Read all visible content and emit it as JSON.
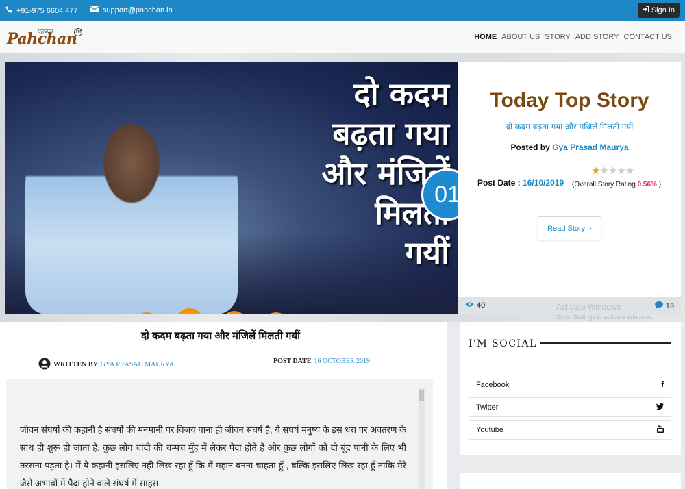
{
  "topbar": {
    "phone": "+91-975 6604 477",
    "email": "support@pahchan.in",
    "signin": "Sign In"
  },
  "logo": {
    "main": "Pahchan",
    "hindi": "पहचान",
    "tm": "TM"
  },
  "nav": [
    "HOME",
    "ABOUT US",
    "STORY",
    "ADD STORY",
    "CONTACT US"
  ],
  "hero": {
    "title_lines": [
      "दो कदम",
      "बढ़ता गया",
      "और मंजिलें",
      "मिलती",
      "गयीं"
    ],
    "badge": "01"
  },
  "story_card": {
    "heading": "Today Top Story",
    "subtitle": "दो कदम बढ़ता गया और मंजिलें मिलती गयीं",
    "posted_by_label": "Posted by",
    "author": "Gya Prasad Maurya",
    "post_date_label": "Post Date :",
    "post_date": "16/10/2019",
    "rating_label_open": "(Overall Story Rating",
    "rating_value": "0.56%",
    "rating_label_close": ")",
    "rating_stars": 0.5,
    "read_button": "Read Story",
    "views": "40",
    "comments": "13"
  },
  "watermark": {
    "line1": "Activate Windows",
    "line2": "Go to Settings to activate Windows."
  },
  "article": {
    "title": "दो कदम बढ़ता गया और मंजिलें मिलती गयीं",
    "written_by_label": "WRITTEN BY",
    "author": "GYA PRASAD MAURYA",
    "post_date_label": "POST DATE",
    "post_date": "16 OCTOBER 2019",
    "body": "जीवन संघर्षो की कहानी है संघर्षो की मनमानी पर विजय पाना ही  जीवन संघर्ष है, ये सघर्ष मनुष्य के इस धरा पर अवतरण के साथ ही शुरू हो जाता है. कुछ लोग चांदी की चम्मच मुँह में लेकर पैदा होते हैं और कुछ लोगों को दो बूंद पानी के लिए भी तरसना पड़ता है। मैं ये कहानी इसलिए नही लिख रहा हूँ कि मैं महान बनना चाहता हूँ , बल्कि इसलिए लिख रहा हूँ ताकि मेरे जैसे अभावों में पैदा होने वाले संघर्ष में साहस"
  },
  "sidebar": {
    "social_title": "I'M SOCIAL",
    "links": [
      {
        "label": "Facebook",
        "icon": "facebook-icon",
        "glyph": "f"
      },
      {
        "label": "Twitter",
        "icon": "twitter-icon",
        "glyph": "🐦"
      },
      {
        "label": "Youtube",
        "icon": "youtube-icon",
        "glyph": "▶"
      }
    ]
  },
  "colors": {
    "primary": "#1e88c7",
    "brand_brown": "#7a4a12",
    "rating_pink": "#e0287a"
  }
}
